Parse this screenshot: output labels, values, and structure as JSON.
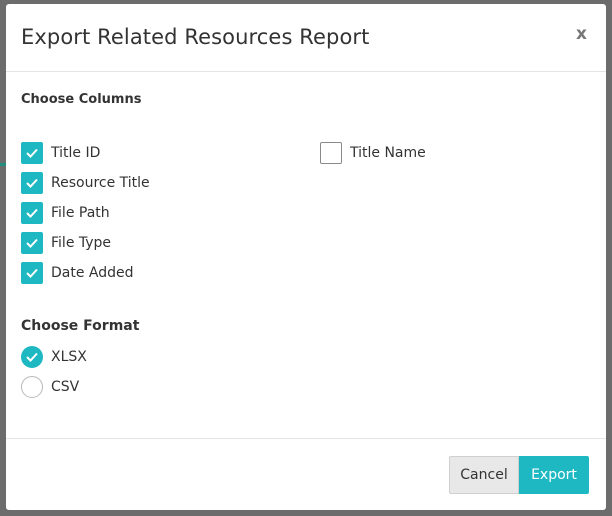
{
  "modal": {
    "title": "Export Related Resources Report",
    "close_label": "x"
  },
  "columns": {
    "label": "Choose Columns",
    "items": [
      {
        "label": "Title ID",
        "checked": true
      },
      {
        "label": "Resource Title",
        "checked": true
      },
      {
        "label": "File Path",
        "checked": true
      },
      {
        "label": "File Type",
        "checked": true
      },
      {
        "label": "Date Added",
        "checked": true
      },
      {
        "label": "Title Name",
        "checked": false
      }
    ]
  },
  "format": {
    "label": "Choose Format",
    "options": [
      {
        "label": "XLSX",
        "selected": true
      },
      {
        "label": "CSV",
        "selected": false
      }
    ]
  },
  "footer": {
    "cancel_label": "Cancel",
    "export_label": "Export"
  },
  "colors": {
    "accent": "#1eb8c3",
    "backdrop": "#6c6c6c"
  }
}
